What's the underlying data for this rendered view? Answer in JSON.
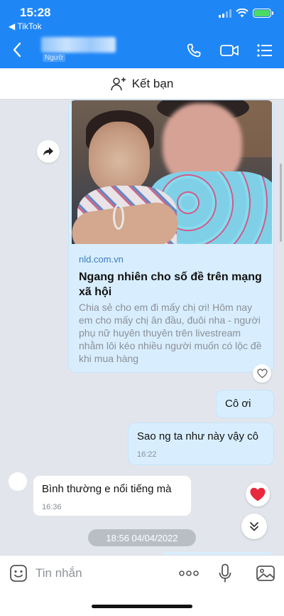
{
  "status_bar": {
    "time": "15:28",
    "back_app": "◀ TikTok"
  },
  "header": {
    "contact_sub_label": "Ngườ"
  },
  "add_friend": {
    "label": "Kết bạn"
  },
  "link_card": {
    "domain": "nld.com.vn",
    "title": "Ngang nhiên cho số đề trên mạng xã hội",
    "description": "Chia sẻ cho em đi mấy chị ơi! Hôm nay em cho mấy chị ăn đầu, đuôi nha - người phụ nữ huyên thuyên trên livestream nhằm lôi kéo nhiều người muốn có lộc đề khi mua hàng"
  },
  "messages": [
    {
      "side": "me",
      "text": "Cô ơi"
    },
    {
      "side": "me",
      "text": "Sao ng ta như này vậy cô",
      "time": "16:22"
    },
    {
      "side": "them",
      "text": "Bình thường e nổi tiếng mà",
      "time": "16:36"
    }
  ],
  "date_separator": "18:56 04/04/2022",
  "input": {
    "placeholder": "Tin nhắn"
  },
  "colors": {
    "header_blue": "#1f86f6",
    "my_bubble": "#d8eeff",
    "their_bubble": "#ffffff",
    "chat_background": "#e2e6ec",
    "heart_red": "#e8283c"
  }
}
